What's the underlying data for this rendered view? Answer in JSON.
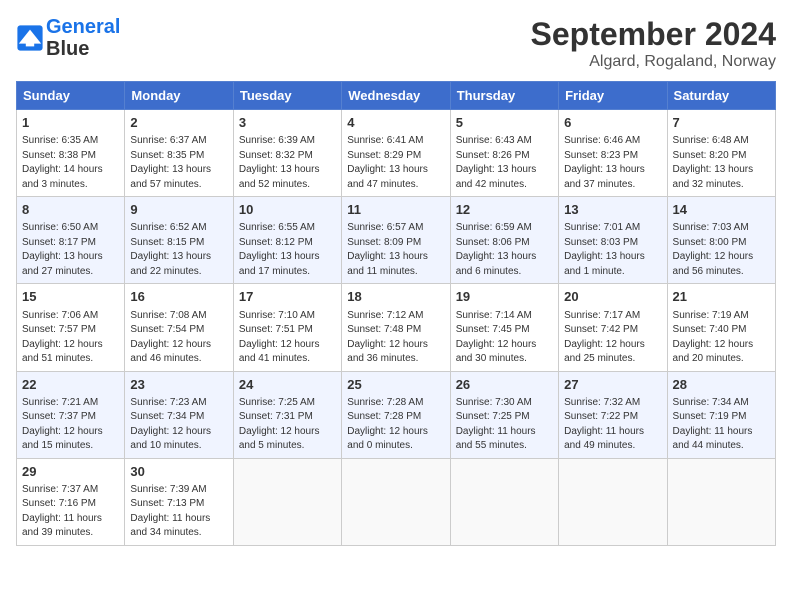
{
  "header": {
    "logo_line1": "General",
    "logo_line2": "Blue",
    "month": "September 2024",
    "location": "Algard, Rogaland, Norway"
  },
  "weekdays": [
    "Sunday",
    "Monday",
    "Tuesday",
    "Wednesday",
    "Thursday",
    "Friday",
    "Saturday"
  ],
  "weeks": [
    [
      {
        "day": "1",
        "detail": "Sunrise: 6:35 AM\nSunset: 8:38 PM\nDaylight: 14 hours\nand 3 minutes."
      },
      {
        "day": "2",
        "detail": "Sunrise: 6:37 AM\nSunset: 8:35 PM\nDaylight: 13 hours\nand 57 minutes."
      },
      {
        "day": "3",
        "detail": "Sunrise: 6:39 AM\nSunset: 8:32 PM\nDaylight: 13 hours\nand 52 minutes."
      },
      {
        "day": "4",
        "detail": "Sunrise: 6:41 AM\nSunset: 8:29 PM\nDaylight: 13 hours\nand 47 minutes."
      },
      {
        "day": "5",
        "detail": "Sunrise: 6:43 AM\nSunset: 8:26 PM\nDaylight: 13 hours\nand 42 minutes."
      },
      {
        "day": "6",
        "detail": "Sunrise: 6:46 AM\nSunset: 8:23 PM\nDaylight: 13 hours\nand 37 minutes."
      },
      {
        "day": "7",
        "detail": "Sunrise: 6:48 AM\nSunset: 8:20 PM\nDaylight: 13 hours\nand 32 minutes."
      }
    ],
    [
      {
        "day": "8",
        "detail": "Sunrise: 6:50 AM\nSunset: 8:17 PM\nDaylight: 13 hours\nand 27 minutes."
      },
      {
        "day": "9",
        "detail": "Sunrise: 6:52 AM\nSunset: 8:15 PM\nDaylight: 13 hours\nand 22 minutes."
      },
      {
        "day": "10",
        "detail": "Sunrise: 6:55 AM\nSunset: 8:12 PM\nDaylight: 13 hours\nand 17 minutes."
      },
      {
        "day": "11",
        "detail": "Sunrise: 6:57 AM\nSunset: 8:09 PM\nDaylight: 13 hours\nand 11 minutes."
      },
      {
        "day": "12",
        "detail": "Sunrise: 6:59 AM\nSunset: 8:06 PM\nDaylight: 13 hours\nand 6 minutes."
      },
      {
        "day": "13",
        "detail": "Sunrise: 7:01 AM\nSunset: 8:03 PM\nDaylight: 13 hours\nand 1 minute."
      },
      {
        "day": "14",
        "detail": "Sunrise: 7:03 AM\nSunset: 8:00 PM\nDaylight: 12 hours\nand 56 minutes."
      }
    ],
    [
      {
        "day": "15",
        "detail": "Sunrise: 7:06 AM\nSunset: 7:57 PM\nDaylight: 12 hours\nand 51 minutes."
      },
      {
        "day": "16",
        "detail": "Sunrise: 7:08 AM\nSunset: 7:54 PM\nDaylight: 12 hours\nand 46 minutes."
      },
      {
        "day": "17",
        "detail": "Sunrise: 7:10 AM\nSunset: 7:51 PM\nDaylight: 12 hours\nand 41 minutes."
      },
      {
        "day": "18",
        "detail": "Sunrise: 7:12 AM\nSunset: 7:48 PM\nDaylight: 12 hours\nand 36 minutes."
      },
      {
        "day": "19",
        "detail": "Sunrise: 7:14 AM\nSunset: 7:45 PM\nDaylight: 12 hours\nand 30 minutes."
      },
      {
        "day": "20",
        "detail": "Sunrise: 7:17 AM\nSunset: 7:42 PM\nDaylight: 12 hours\nand 25 minutes."
      },
      {
        "day": "21",
        "detail": "Sunrise: 7:19 AM\nSunset: 7:40 PM\nDaylight: 12 hours\nand 20 minutes."
      }
    ],
    [
      {
        "day": "22",
        "detail": "Sunrise: 7:21 AM\nSunset: 7:37 PM\nDaylight: 12 hours\nand 15 minutes."
      },
      {
        "day": "23",
        "detail": "Sunrise: 7:23 AM\nSunset: 7:34 PM\nDaylight: 12 hours\nand 10 minutes."
      },
      {
        "day": "24",
        "detail": "Sunrise: 7:25 AM\nSunset: 7:31 PM\nDaylight: 12 hours\nand 5 minutes."
      },
      {
        "day": "25",
        "detail": "Sunrise: 7:28 AM\nSunset: 7:28 PM\nDaylight: 12 hours\nand 0 minutes."
      },
      {
        "day": "26",
        "detail": "Sunrise: 7:30 AM\nSunset: 7:25 PM\nDaylight: 11 hours\nand 55 minutes."
      },
      {
        "day": "27",
        "detail": "Sunrise: 7:32 AM\nSunset: 7:22 PM\nDaylight: 11 hours\nand 49 minutes."
      },
      {
        "day": "28",
        "detail": "Sunrise: 7:34 AM\nSunset: 7:19 PM\nDaylight: 11 hours\nand 44 minutes."
      }
    ],
    [
      {
        "day": "29",
        "detail": "Sunrise: 7:37 AM\nSunset: 7:16 PM\nDaylight: 11 hours\nand 39 minutes."
      },
      {
        "day": "30",
        "detail": "Sunrise: 7:39 AM\nSunset: 7:13 PM\nDaylight: 11 hours\nand 34 minutes."
      },
      null,
      null,
      null,
      null,
      null
    ]
  ]
}
